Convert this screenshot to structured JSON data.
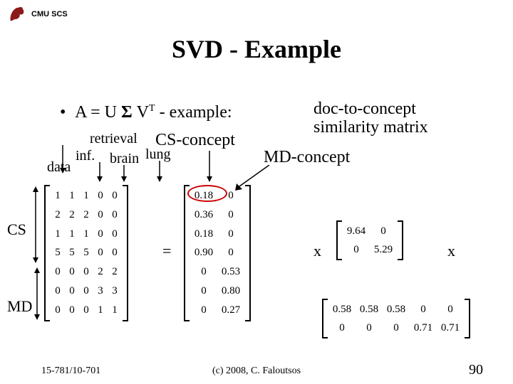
{
  "header": {
    "org": "CMU SCS"
  },
  "title": "SVD - Example",
  "bullet": {
    "pre": "A = U ",
    "sigma": "Σ",
    "post": " V",
    "sup": "T",
    "tail": " - example:"
  },
  "labels": {
    "retrieval": "retrieval",
    "cs_concept": "CS-concept",
    "inf": "inf.",
    "brain": "brain",
    "lung": "lung",
    "data": "data",
    "md_concept": "MD-concept",
    "doc_to": "doc-to-concept",
    "sim": "similarity matrix",
    "cs": "CS",
    "md": "MD",
    "equals": "=",
    "times": "x"
  },
  "matrices": {
    "A": [
      [
        "1",
        "1",
        "1",
        "0",
        "0"
      ],
      [
        "2",
        "2",
        "2",
        "0",
        "0"
      ],
      [
        "1",
        "1",
        "1",
        "0",
        "0"
      ],
      [
        "5",
        "5",
        "5",
        "0",
        "0"
      ],
      [
        "0",
        "0",
        "0",
        "2",
        "2"
      ],
      [
        "0",
        "0",
        "0",
        "3",
        "3"
      ],
      [
        "0",
        "0",
        "0",
        "1",
        "1"
      ]
    ],
    "U": [
      [
        "0.18",
        "0"
      ],
      [
        "0.36",
        "0"
      ],
      [
        "0.18",
        "0"
      ],
      [
        "0.90",
        "0"
      ],
      [
        "0",
        "0.53"
      ],
      [
        "0",
        "0.80"
      ],
      [
        "0",
        "0.27"
      ]
    ],
    "S": [
      [
        "9.64",
        "0"
      ],
      [
        "0",
        "5.29"
      ]
    ],
    "V": [
      [
        "0.58",
        "0.58",
        "0.58",
        "0",
        "0"
      ],
      [
        "0",
        "0",
        "0",
        "0.71",
        "0.71"
      ]
    ]
  },
  "footer": {
    "left": "15-781/10-701",
    "center": "(c) 2008, C. Faloutsos",
    "page": "90"
  }
}
